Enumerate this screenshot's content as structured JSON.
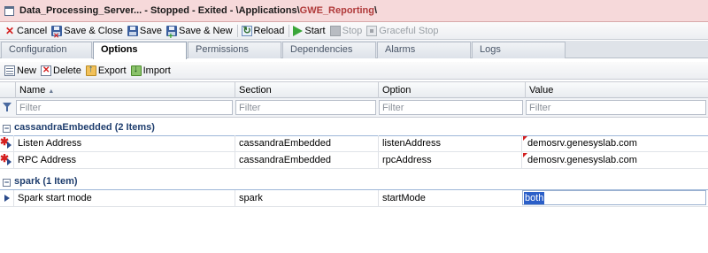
{
  "window": {
    "title_text": "Data_Processing_Server... - Stopped - Exited - \\Applications\\",
    "title_app": "GWE_Reporting",
    "title_suffix": "\\"
  },
  "toolbar": {
    "cancel": "Cancel",
    "save_close": "Save & Close",
    "save": "Save",
    "save_new": "Save & New",
    "reload": "Reload",
    "start": "Start",
    "stop": "Stop",
    "graceful_stop": "Graceful Stop"
  },
  "tabs": [
    "Configuration",
    "Options",
    "Permissions",
    "Dependencies",
    "Alarms",
    "Logs"
  ],
  "active_tab": "Options",
  "subtoolbar": {
    "new": "New",
    "delete": "Delete",
    "export": "Export",
    "import": "Import"
  },
  "grid": {
    "columns": {
      "name": "Name",
      "section": "Section",
      "option": "Option",
      "value": "Value"
    },
    "filter_placeholder": "Filter",
    "groups": [
      {
        "label": "cassandraEmbedded (2 Items)",
        "rows": [
          {
            "name": "Listen Address",
            "section": "cassandraEmbedded",
            "option": "listenAddress",
            "value": "demosrv.genesyslab.com"
          },
          {
            "name": "RPC Address",
            "section": "cassandraEmbedded",
            "option": "rpcAddress",
            "value": "demosrv.genesyslab.com"
          }
        ]
      },
      {
        "label": "spark (1 Item)",
        "rows": [
          {
            "name": "Spark start mode",
            "section": "spark",
            "option": "startMode",
            "value": "both"
          }
        ]
      }
    ]
  },
  "colors": {
    "title_bg": "#f6d9da",
    "group_text": "#1f3e6e",
    "selection": "#2b5fc8",
    "required": "#d42020"
  }
}
